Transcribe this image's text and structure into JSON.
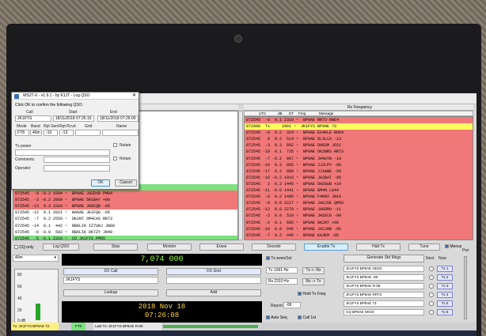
{
  "colors": {
    "decode_red": "#f07878",
    "cq_green": "#7ee07e",
    "highlight_yellow": "#ffff60",
    "freq_text": "#9cff3c",
    "date_text": "#ffd23c"
  },
  "log_dialog": {
    "title": "WSJT-X - v1.9.1 - by K1JT - Log QSO",
    "instruction": "Click OK to confirm the following QSO:",
    "headers": {
      "call": "Call",
      "start": "Start",
      "end": "End"
    },
    "call": "JK1FYS",
    "start": "18/11/2018 07:25:15",
    "end": "18/11/2018 07:26:00",
    "cols": {
      "mode": "Mode",
      "band": "Band",
      "rpt_sent": "Rpt Sent",
      "rpt_rcvd": "Rpt Rcvd",
      "grid": "Grid",
      "name": "Name"
    },
    "mode": "FT8",
    "band": "40m",
    "rpt_sent": "-10",
    "rpt_rcvd": "-13",
    "grid": "",
    "name": "",
    "tx_power_label": "Tx power",
    "comments_label": "Comments",
    "operator_label": "Operator",
    "retain1": "Retain",
    "retain2": "Retain",
    "ok": "OK",
    "cancel": "Cancel"
  },
  "band_activity": {
    "rows": [
      {
        "text": "072545 -20  0.3 556 ~  CQ R2Y1 KL17",
        "color": "green"
      },
      {
        "text": "072545  -6 -0.2 1694 ~  BP9AE JA2DXR PM84",
        "color": "red"
      },
      {
        "text": "072545  -3 -0.2 2060 ~  BP9AE 5R1BAY +00",
        "color": "red"
      },
      {
        "text": "072545 -13  0.3 2310 ~  BP9AE JG0CQB -06",
        "color": "red"
      },
      {
        "text": "072545 -12  0.1 2021 ~  BA6AE JE1FQG -05",
        "color": "plain"
      },
      {
        "text": "072545  -7  0.2 2550 ~  DK2NT SM4CAS RR73",
        "color": "plain"
      },
      {
        "text": "072545 -14  0.1  442 ~  RB6LIK IZ7UNJ JN80",
        "color": "plain"
      },
      {
        "text": "072545  -6 -0.8  502 ~  RB6LIK DK7ZY JN49",
        "color": "plain"
      },
      {
        "text": "072545  -5 -0.1 2310 ~  CQ JK1FYS PM95",
        "color": "green"
      }
    ]
  },
  "rx_frequency": {
    "header": "Rx Frequency",
    "columns": {
      "utc": "UTC",
      "db": "dB",
      "dt": "DT",
      "freq": "Freq",
      "message": "Message"
    },
    "rows": [
      {
        "text": "072545  -6  0.1 2310 ~  BP9AE RR73 0NE4",
        "color": "red"
      },
      {
        "text": "072600  Tx     1061 ~  JK1FYS BP9AE 73",
        "color": "yellow"
      },
      {
        "text": "072545  -8  0.2  324 ~  BP9AE EX4KLE RO04",
        "color": "red"
      },
      {
        "text": "072545   0  0.2  514 ~  BP9AE DL3LCA -13",
        "color": "red"
      },
      {
        "text": "072545  -3  0.3  602 ~  BP9AE DH6SM JO21",
        "color": "red"
      },
      {
        "text": "072545 -10  0.1  735 ~  BP9AE OK2BRS RR73",
        "color": "red"
      },
      {
        "text": "072545  -7 -0.2  807 ~  BP9AE JH4UYB -10",
        "color": "red"
      },
      {
        "text": "072545 -16  0.3  865 ~  BP9AE JJ2LPV -09",
        "color": "red"
      },
      {
        "text": "072545 -17  0.2  980 ~  BP9AE JJ1WWE -08",
        "color": "red"
      },
      {
        "text": "072545 -16 -0.2 1019 ~  BP9AE JA2BAT -05",
        "color": "red"
      },
      {
        "text": "072545   2  0.3 1445 ~  BP9AE DH2GUB +10",
        "color": "red"
      },
      {
        "text": "072545 -11 -0.0 1441 ~  BP9AE BM4N L044",
        "color": "red"
      },
      {
        "text": "072545  -8  0.2 1495 ~  BP9AE F4KRX JN19",
        "color": "red"
      },
      {
        "text": "072545  -9  0.8 2227 ~  BP9AE JA6JSE QM59",
        "color": "red"
      },
      {
        "text": "072545 -12  0.0 2270 ~  BP9AE JA8DRH -11",
        "color": "red"
      },
      {
        "text": "072545  -2  0.0  518 ~  BP9AE JH1ECG -09",
        "color": "red"
      },
      {
        "text": "072545  -2  0.1  695 ~  BP9AE DK2NT +06",
        "color": "red"
      },
      {
        "text": "072545 -10  0.8  945 ~  BP9AE JA2JHB -05",
        "color": "red"
      },
      {
        "text": "072545  -7  0.2  445 ~  BP9AE KA3EM -05",
        "color": "red"
      },
      {
        "text": "072545 -14 -0.0 1420 ~  BP9AE JA2SDF RR73",
        "color": "red"
      },
      {
        "text": "072545 -8  -0.2 2097 ~  BP9AE 5R1BAY +00",
        "color": "red"
      },
      {
        "text": "072545  -2  0.3 2310 ~  BP9AE JG0CQB -08",
        "color": "red"
      }
    ]
  },
  "controls": {
    "cq_only": "CQ only",
    "log_qso": "Log QSO",
    "stop": "Stop",
    "monitor": "Monitor",
    "erase": "Erase",
    "decode": "Decode",
    "enable_tx": "Enable Tx",
    "halt_tx": "Halt Tx",
    "tune": "Tune",
    "menus": "Menus"
  },
  "band_select": "40m",
  "dial_frequency": "7,074 000",
  "dx_call_label": "DX Call",
  "dx_grid_label": "DX Grid",
  "dx_call": "JK1FYS",
  "dx_grid": "",
  "lookup": "Lookup",
  "add": "Add",
  "date": "2018 Nov 18",
  "time": "07:26:08",
  "tx_even_label": "Tx even/1st",
  "tx_hz": "Tx 1061 Hz",
  "rx_hz": "Rx 2310 Hz",
  "tx_to_rx": "Tx <- Rx",
  "rx_to_tx": "Rx -> Tx",
  "hold_tx_freq": "Hold Tx Freq",
  "report_label": "Report",
  "report_value": "-08",
  "auto_seq": "Auto Seq",
  "call_1st": "Call 1st",
  "meter_ticks": [
    "80",
    "60",
    "40",
    "20",
    "0 dB"
  ],
  "meter_level_pct": 35,
  "generate_std_msgs": "Generate Std Msgs",
  "next_label": "Next",
  "now_label": "Now",
  "pwr_label": "Pwr",
  "tx_messages": [
    {
      "text": "JK1FYS BP9AE OK03",
      "tx": "Tx 1"
    },
    {
      "text": "JK1FYS BP9AE -08",
      "tx": "Tx 2"
    },
    {
      "text": "JK1FYS BP9AE R-08",
      "tx": "Tx 3"
    },
    {
      "text": "JK1FYS BP9AE RR73",
      "tx": "Tx 4"
    },
    {
      "text": "JK1FYS BP9AE 73",
      "tx": "Tx 5"
    },
    {
      "text": "CQ BP9AE OK03",
      "tx": "Tx 6"
    }
  ],
  "status": {
    "mode_state": "Tx: JK1FYS BP9AE 73",
    "mode": "FT8",
    "last_tx": "Last Tx: JK1FYS BP9AE R-08"
  }
}
